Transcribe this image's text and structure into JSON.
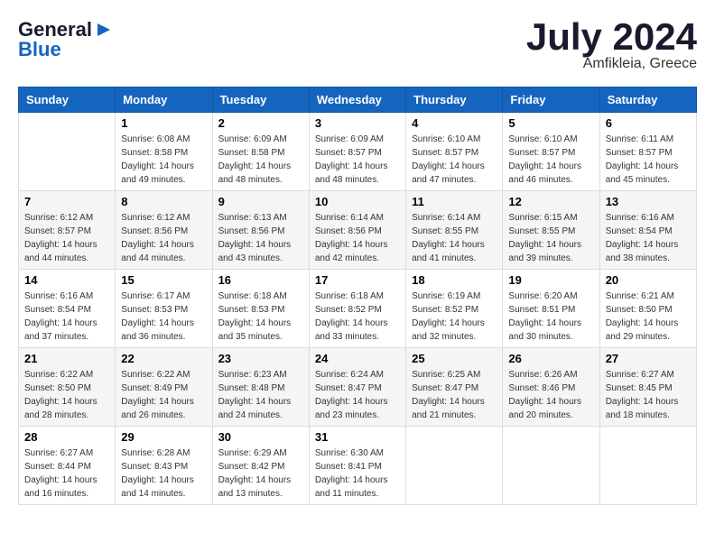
{
  "header": {
    "logo_general": "General",
    "logo_blue": "Blue",
    "title": "July 2024",
    "subtitle": "Amfikleia, Greece"
  },
  "calendar": {
    "days_of_week": [
      "Sunday",
      "Monday",
      "Tuesday",
      "Wednesday",
      "Thursday",
      "Friday",
      "Saturday"
    ],
    "weeks": [
      [
        {
          "day": "",
          "info": ""
        },
        {
          "day": "1",
          "info": "Sunrise: 6:08 AM\nSunset: 8:58 PM\nDaylight: 14 hours\nand 49 minutes."
        },
        {
          "day": "2",
          "info": "Sunrise: 6:09 AM\nSunset: 8:58 PM\nDaylight: 14 hours\nand 48 minutes."
        },
        {
          "day": "3",
          "info": "Sunrise: 6:09 AM\nSunset: 8:57 PM\nDaylight: 14 hours\nand 48 minutes."
        },
        {
          "day": "4",
          "info": "Sunrise: 6:10 AM\nSunset: 8:57 PM\nDaylight: 14 hours\nand 47 minutes."
        },
        {
          "day": "5",
          "info": "Sunrise: 6:10 AM\nSunset: 8:57 PM\nDaylight: 14 hours\nand 46 minutes."
        },
        {
          "day": "6",
          "info": "Sunrise: 6:11 AM\nSunset: 8:57 PM\nDaylight: 14 hours\nand 45 minutes."
        }
      ],
      [
        {
          "day": "7",
          "info": "Sunrise: 6:12 AM\nSunset: 8:57 PM\nDaylight: 14 hours\nand 44 minutes."
        },
        {
          "day": "8",
          "info": "Sunrise: 6:12 AM\nSunset: 8:56 PM\nDaylight: 14 hours\nand 44 minutes."
        },
        {
          "day": "9",
          "info": "Sunrise: 6:13 AM\nSunset: 8:56 PM\nDaylight: 14 hours\nand 43 minutes."
        },
        {
          "day": "10",
          "info": "Sunrise: 6:14 AM\nSunset: 8:56 PM\nDaylight: 14 hours\nand 42 minutes."
        },
        {
          "day": "11",
          "info": "Sunrise: 6:14 AM\nSunset: 8:55 PM\nDaylight: 14 hours\nand 41 minutes."
        },
        {
          "day": "12",
          "info": "Sunrise: 6:15 AM\nSunset: 8:55 PM\nDaylight: 14 hours\nand 39 minutes."
        },
        {
          "day": "13",
          "info": "Sunrise: 6:16 AM\nSunset: 8:54 PM\nDaylight: 14 hours\nand 38 minutes."
        }
      ],
      [
        {
          "day": "14",
          "info": "Sunrise: 6:16 AM\nSunset: 8:54 PM\nDaylight: 14 hours\nand 37 minutes."
        },
        {
          "day": "15",
          "info": "Sunrise: 6:17 AM\nSunset: 8:53 PM\nDaylight: 14 hours\nand 36 minutes."
        },
        {
          "day": "16",
          "info": "Sunrise: 6:18 AM\nSunset: 8:53 PM\nDaylight: 14 hours\nand 35 minutes."
        },
        {
          "day": "17",
          "info": "Sunrise: 6:18 AM\nSunset: 8:52 PM\nDaylight: 14 hours\nand 33 minutes."
        },
        {
          "day": "18",
          "info": "Sunrise: 6:19 AM\nSunset: 8:52 PM\nDaylight: 14 hours\nand 32 minutes."
        },
        {
          "day": "19",
          "info": "Sunrise: 6:20 AM\nSunset: 8:51 PM\nDaylight: 14 hours\nand 30 minutes."
        },
        {
          "day": "20",
          "info": "Sunrise: 6:21 AM\nSunset: 8:50 PM\nDaylight: 14 hours\nand 29 minutes."
        }
      ],
      [
        {
          "day": "21",
          "info": "Sunrise: 6:22 AM\nSunset: 8:50 PM\nDaylight: 14 hours\nand 28 minutes."
        },
        {
          "day": "22",
          "info": "Sunrise: 6:22 AM\nSunset: 8:49 PM\nDaylight: 14 hours\nand 26 minutes."
        },
        {
          "day": "23",
          "info": "Sunrise: 6:23 AM\nSunset: 8:48 PM\nDaylight: 14 hours\nand 24 minutes."
        },
        {
          "day": "24",
          "info": "Sunrise: 6:24 AM\nSunset: 8:47 PM\nDaylight: 14 hours\nand 23 minutes."
        },
        {
          "day": "25",
          "info": "Sunrise: 6:25 AM\nSunset: 8:47 PM\nDaylight: 14 hours\nand 21 minutes."
        },
        {
          "day": "26",
          "info": "Sunrise: 6:26 AM\nSunset: 8:46 PM\nDaylight: 14 hours\nand 20 minutes."
        },
        {
          "day": "27",
          "info": "Sunrise: 6:27 AM\nSunset: 8:45 PM\nDaylight: 14 hours\nand 18 minutes."
        }
      ],
      [
        {
          "day": "28",
          "info": "Sunrise: 6:27 AM\nSunset: 8:44 PM\nDaylight: 14 hours\nand 16 minutes."
        },
        {
          "day": "29",
          "info": "Sunrise: 6:28 AM\nSunset: 8:43 PM\nDaylight: 14 hours\nand 14 minutes."
        },
        {
          "day": "30",
          "info": "Sunrise: 6:29 AM\nSunset: 8:42 PM\nDaylight: 14 hours\nand 13 minutes."
        },
        {
          "day": "31",
          "info": "Sunrise: 6:30 AM\nSunset: 8:41 PM\nDaylight: 14 hours\nand 11 minutes."
        },
        {
          "day": "",
          "info": ""
        },
        {
          "day": "",
          "info": ""
        },
        {
          "day": "",
          "info": ""
        }
      ]
    ]
  }
}
